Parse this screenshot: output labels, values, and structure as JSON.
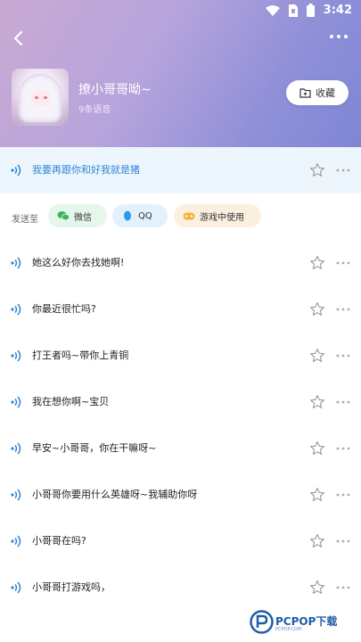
{
  "status_bar": {
    "time": "3:42"
  },
  "header": {
    "title": "撩小哥哥呦~",
    "subtitle": "9条语音",
    "favorite_label": "收藏",
    "cover_icon": "anime-girl-cover-image"
  },
  "active_item": {
    "text": "我要再跟你和好我就是猪"
  },
  "share": {
    "label": "发送至",
    "wechat": "微信",
    "qq": "QQ",
    "game": "游戏中使用"
  },
  "items": [
    {
      "text": "她这么好你去找她啊!"
    },
    {
      "text": "你最近很忙吗?"
    },
    {
      "text": "打王者吗~带你上青铜"
    },
    {
      "text": "我在想你啊~宝贝"
    },
    {
      "text": "早安~小哥哥，你在干嘛呀~"
    },
    {
      "text": "小哥哥你要用什么英雄呀~我辅助你呀"
    },
    {
      "text": "小哥哥在吗?"
    },
    {
      "text": "小哥哥打游戏吗，"
    }
  ],
  "watermark": {
    "brand": "PCPOP下载",
    "sub": "PCPOP.COM"
  },
  "colors": {
    "accent_blue": "#2e86d6",
    "header_gradient_start": "#c9a9d3",
    "header_gradient_end": "#7f86d6",
    "active_row_bg": "#eef6fd"
  }
}
